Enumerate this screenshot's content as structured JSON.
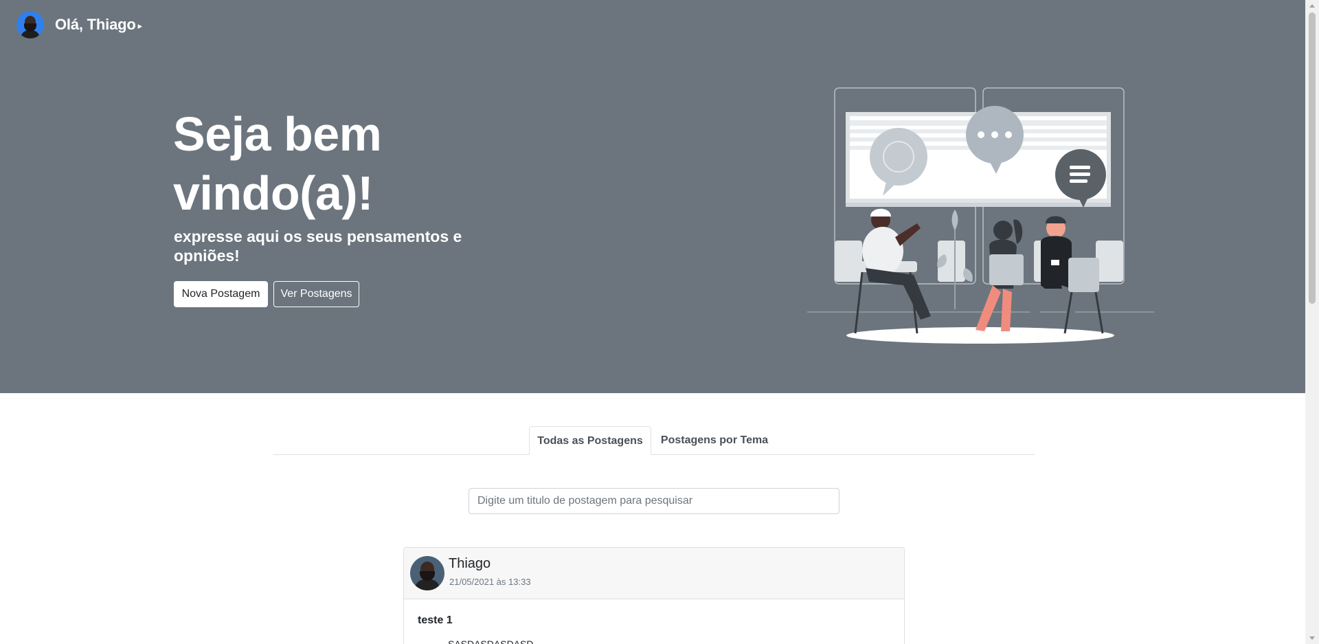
{
  "header": {
    "greeting": "Olá, Thiago",
    "caret": "›"
  },
  "hero": {
    "title": "Seja bem vindo(a)!",
    "subtitle": "expresse aqui os seus pensamentos e opniões!",
    "new_post_label": "Nova Postagem",
    "view_posts_label": "Ver Postagens",
    "background_color": "#6c757d"
  },
  "tabs": [
    {
      "label": "Todas as Postagens",
      "active": true
    },
    {
      "label": "Postagens por Tema",
      "active": false
    }
  ],
  "search": {
    "placeholder": "Digite um titulo de postagem para pesquisar",
    "value": ""
  },
  "posts": [
    {
      "author": "Thiago",
      "date": "21/05/2021 às 13:33",
      "title": "teste 1",
      "text": "SASDASDASDASD"
    }
  ],
  "icons": {
    "caret": "chevron-right-icon",
    "illustration": "meeting-illustration"
  }
}
